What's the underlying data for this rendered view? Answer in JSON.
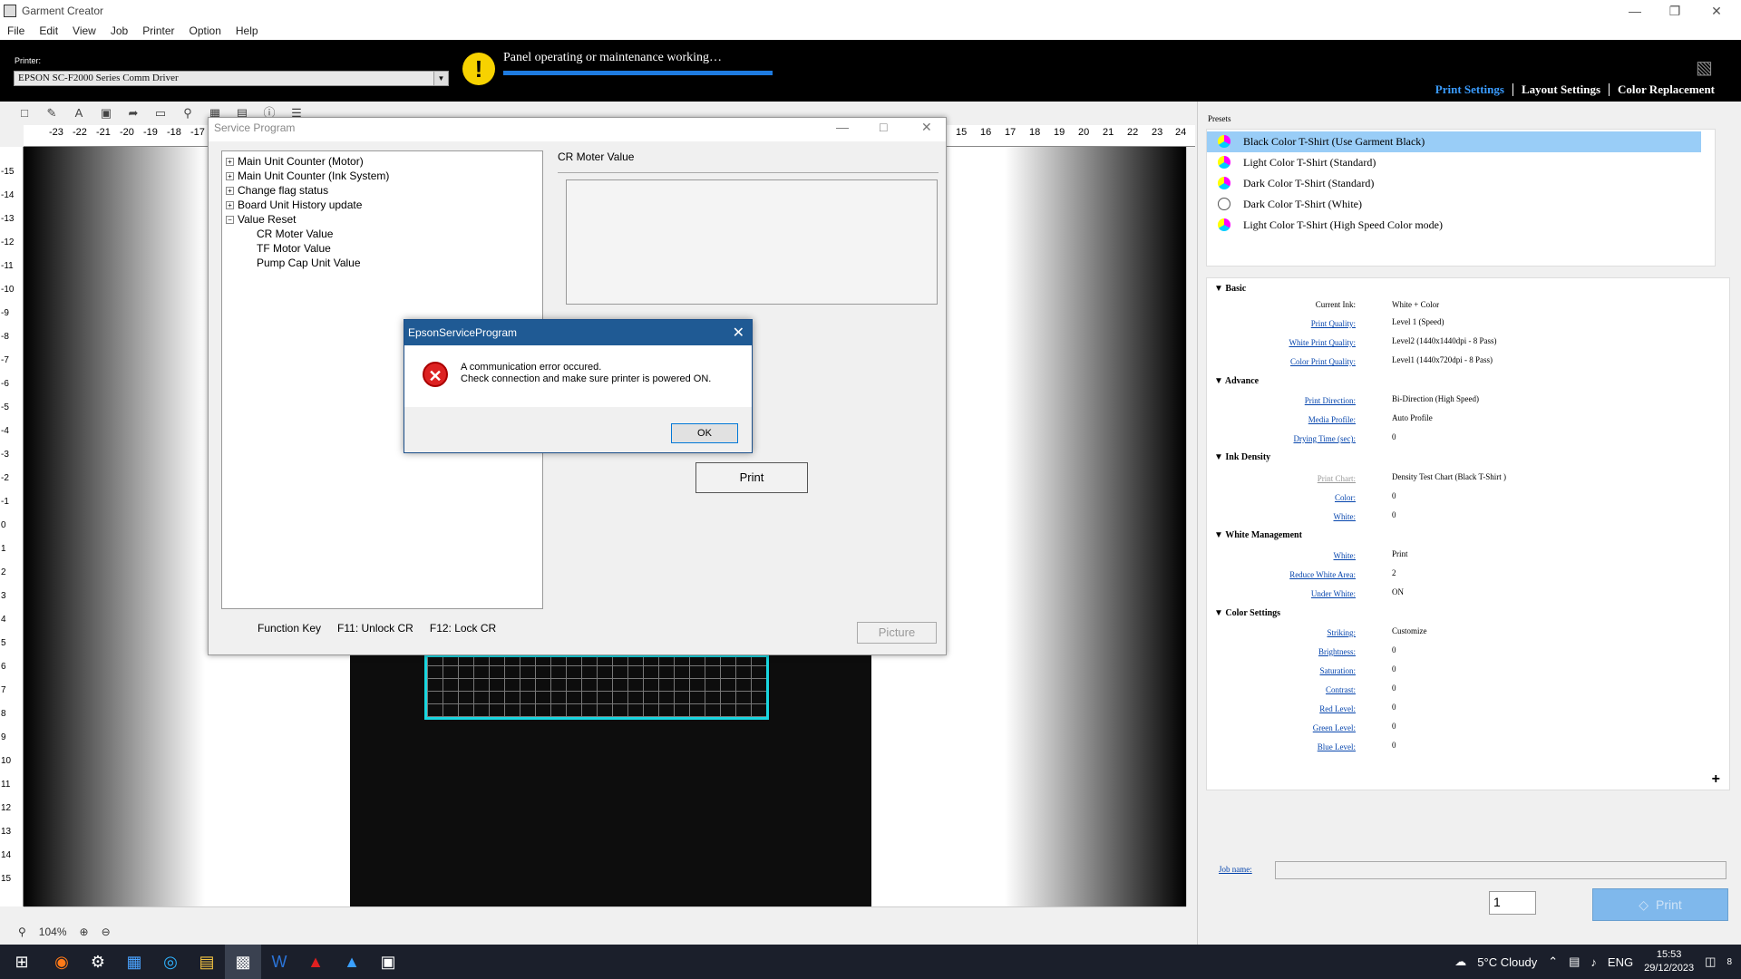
{
  "window": {
    "title": "Garment Creator"
  },
  "menu": [
    "File",
    "Edit",
    "View",
    "Job",
    "Printer",
    "Option",
    "Help"
  ],
  "header": {
    "printer_label": "Printer:",
    "printer_value": "EPSON SC-F2000 Series Comm Driver",
    "status_text": "Panel operating or maintenance working…",
    "tabs": [
      "Print Settings",
      "Layout Settings",
      "Color Replacement"
    ]
  },
  "ruler_top": [
    "-23",
    "-22",
    "-21",
    "-20",
    "-19",
    "-18",
    "-17",
    "15",
    "16",
    "17",
    "18",
    "19",
    "20",
    "21",
    "22",
    "23",
    "24"
  ],
  "ruler_left": [
    "-15",
    "-14",
    "-13",
    "-12",
    "-11",
    "-10",
    "-9",
    "-8",
    "-7",
    "-6",
    "-5",
    "-4",
    "-3",
    "-2",
    "-1",
    "0",
    "1",
    "2",
    "3",
    "4",
    "5",
    "6",
    "7",
    "8",
    "9",
    "10",
    "11",
    "12",
    "13",
    "14",
    "15"
  ],
  "zoom": {
    "level": "104%"
  },
  "presets": {
    "label": "Presets",
    "items": [
      {
        "label": "Black Color T-Shirt (Use Garment Black)",
        "selected": true
      },
      {
        "label": "Light Color T-Shirt (Standard)",
        "selected": false
      },
      {
        "label": "Dark Color T-Shirt (Standard)",
        "selected": false
      },
      {
        "label": "Dark Color T-Shirt (White)",
        "selected": false
      },
      {
        "label": "Light Color T-Shirt (High Speed Color mode)",
        "selected": false
      }
    ]
  },
  "settings": {
    "basic": {
      "title": "Basic",
      "rows": [
        {
          "label": "Current Ink:",
          "value": "White + Color"
        },
        {
          "label": "Print Quality:",
          "value": "Level 1 (Speed)"
        },
        {
          "label": "White Print Quality:",
          "value": "Level2 (1440x1440dpi - 8 Pass)"
        },
        {
          "label": "Color Print Quality:",
          "value": "Level1 (1440x720dpi - 8 Pass)"
        }
      ]
    },
    "advance": {
      "title": "Advance",
      "rows": [
        {
          "label": "Print Direction:",
          "value": "Bi-Direction (High Speed)"
        },
        {
          "label": "Media Profile:",
          "value": "Auto Profile"
        },
        {
          "label": "Drying Time (sec):",
          "value": "0"
        }
      ]
    },
    "ink_density": {
      "title": "Ink Density",
      "rows": [
        {
          "label": "Print Chart:",
          "value": "Density Test Chart (Black T-Shirt )"
        },
        {
          "label": "Color:",
          "value": "0"
        },
        {
          "label": "White:",
          "value": "0"
        }
      ]
    },
    "white_mgmt": {
      "title": "White Management",
      "rows": [
        {
          "label": "White:",
          "value": "Print"
        },
        {
          "label": "Reduce White Area:",
          "value": "2"
        },
        {
          "label": "Under White:",
          "value": "ON"
        }
      ]
    },
    "color_settings": {
      "title": "Color Settings",
      "rows": [
        {
          "label": "Striking:",
          "value": "Customize"
        },
        {
          "label": "Brightness:",
          "value": "0"
        },
        {
          "label": "Saturation:",
          "value": "0"
        },
        {
          "label": "Contrast:",
          "value": "0"
        },
        {
          "label": "Red Level:",
          "value": "0"
        },
        {
          "label": "Green Level:",
          "value": "0"
        },
        {
          "label": "Blue Level:",
          "value": "0"
        }
      ]
    }
  },
  "job": {
    "name_label": "Job name:",
    "name_value": "",
    "copies": "1",
    "print_label": "Print"
  },
  "service": {
    "title": "Service Program",
    "tree": [
      {
        "label": "Main Unit Counter (Motor)",
        "expander": "+"
      },
      {
        "label": "Main Unit Counter (Ink System)",
        "expander": "+"
      },
      {
        "label": "Change flag status",
        "expander": "+"
      },
      {
        "label": "Board Unit History update",
        "expander": "+"
      },
      {
        "label": "Value Reset",
        "expander": "−"
      },
      {
        "label": "CR Moter Value",
        "expander": ""
      },
      {
        "label": "TF Motor Value",
        "expander": ""
      },
      {
        "label": "Pump Cap Unit Value",
        "expander": ""
      }
    ],
    "panel_title": "CR Moter Value",
    "print_button": "Print",
    "function_key": "Function Key",
    "f11": "F11: Unlock CR",
    "f12": "F12: Lock CR",
    "picture_button": "Picture"
  },
  "error_dialog": {
    "title": "EpsonServiceProgram",
    "line1": "A communication error occured.",
    "line2": "Check connection and make sure printer is powered ON.",
    "ok": "OK"
  },
  "taskbar": {
    "weather": "5°C  Cloudy",
    "lang": "ENG",
    "time": "15:53",
    "date": "29/12/2023",
    "notifications": "8"
  }
}
